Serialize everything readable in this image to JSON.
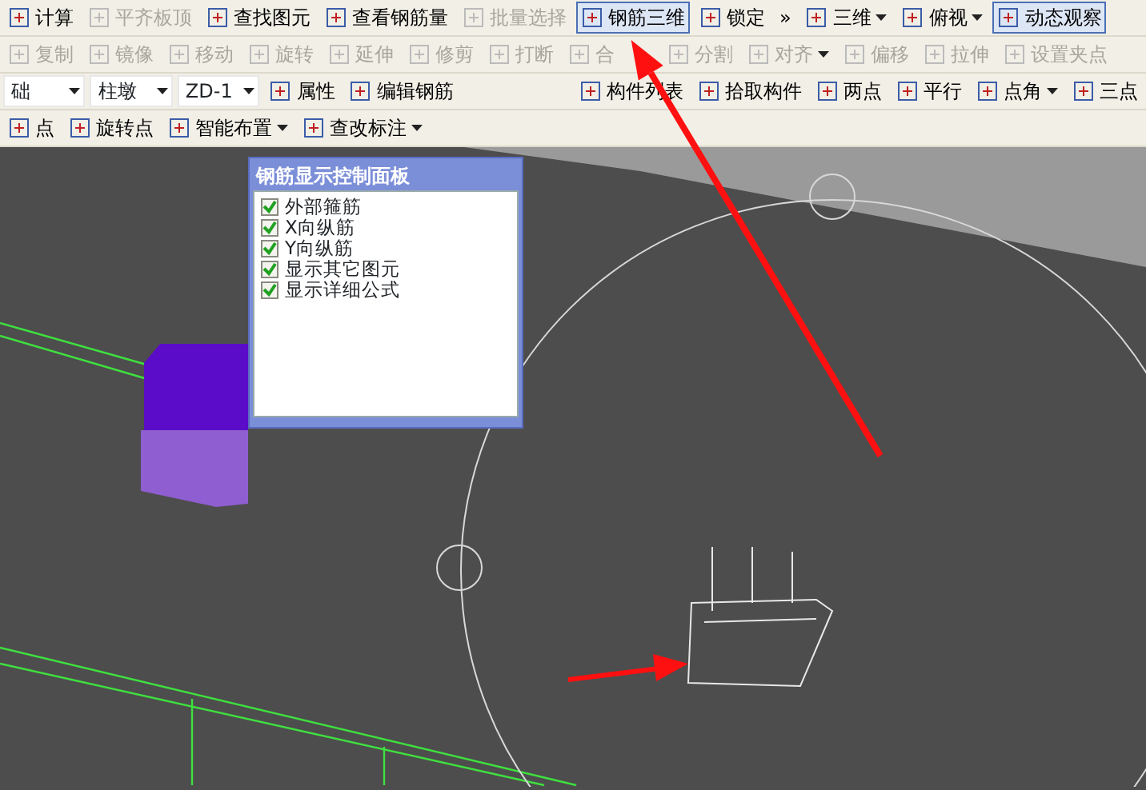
{
  "toolbars": [
    {
      "items": [
        {
          "kind": "button",
          "label": "计算",
          "disabled": false,
          "pressed": false
        },
        {
          "kind": "button",
          "label": "平齐板顶",
          "disabled": true,
          "pressed": false
        },
        {
          "kind": "button",
          "label": "查找图元",
          "disabled": false,
          "pressed": false
        },
        {
          "kind": "button",
          "label": "查看钢筋量",
          "disabled": false,
          "pressed": false
        },
        {
          "kind": "button",
          "label": "批量选择",
          "disabled": true,
          "pressed": false
        },
        {
          "kind": "button",
          "label": "钢筋三维",
          "disabled": false,
          "pressed": true
        },
        {
          "kind": "button",
          "label": "锁定",
          "disabled": false,
          "pressed": false
        },
        {
          "kind": "more",
          "label": "»",
          "disabled": false,
          "pressed": false
        },
        {
          "kind": "dropdown",
          "label": "三维",
          "disabled": false,
          "pressed": false
        },
        {
          "kind": "dropdown",
          "label": "俯视",
          "disabled": false,
          "pressed": false
        },
        {
          "kind": "button",
          "label": "动态观察",
          "disabled": false,
          "pressed": true
        }
      ]
    },
    {
      "items": [
        {
          "kind": "button",
          "label": "复制",
          "disabled": true,
          "pressed": false
        },
        {
          "kind": "button",
          "label": "镜像",
          "disabled": true,
          "pressed": false
        },
        {
          "kind": "button",
          "label": "移动",
          "disabled": true,
          "pressed": false
        },
        {
          "kind": "button",
          "label": "旋转",
          "disabled": true,
          "pressed": false
        },
        {
          "kind": "button",
          "label": "延伸",
          "disabled": true,
          "pressed": false
        },
        {
          "kind": "button",
          "label": "修剪",
          "disabled": true,
          "pressed": false
        },
        {
          "kind": "button",
          "label": "打断",
          "disabled": true,
          "pressed": false
        },
        {
          "kind": "button",
          "label": "合",
          "disabled": true,
          "pressed": false
        },
        {
          "kind": "button",
          "label": "分割",
          "disabled": true,
          "pressed": false
        },
        {
          "kind": "dropdown",
          "label": "对齐",
          "disabled": true,
          "pressed": false
        },
        {
          "kind": "button",
          "label": "偏移",
          "disabled": true,
          "pressed": false
        },
        {
          "kind": "button",
          "label": "拉伸",
          "disabled": true,
          "pressed": false
        },
        {
          "kind": "button",
          "label": "设置夹点",
          "disabled": true,
          "pressed": false
        }
      ]
    },
    {
      "items": [
        {
          "kind": "select",
          "label": "础"
        },
        {
          "kind": "select",
          "label": "柱墩"
        },
        {
          "kind": "select",
          "label": "ZD-1"
        },
        {
          "kind": "button",
          "label": "属性",
          "disabled": false,
          "pressed": false
        },
        {
          "kind": "button",
          "label": "编辑钢筋",
          "disabled": false,
          "pressed": false
        },
        {
          "kind": "button",
          "label": "构件列表",
          "disabled": false,
          "pressed": false
        },
        {
          "kind": "button",
          "label": "拾取构件",
          "disabled": false,
          "pressed": false
        },
        {
          "kind": "button",
          "label": "两点",
          "disabled": false,
          "pressed": false
        },
        {
          "kind": "button",
          "label": "平行",
          "disabled": false,
          "pressed": false
        },
        {
          "kind": "dropdown",
          "label": "点角",
          "disabled": false,
          "pressed": false
        },
        {
          "kind": "button",
          "label": "三点",
          "disabled": false,
          "pressed": false
        }
      ]
    },
    {
      "items": [
        {
          "kind": "button",
          "label": "点",
          "disabled": false,
          "pressed": false
        },
        {
          "kind": "button",
          "label": "旋转点",
          "disabled": false,
          "pressed": false
        },
        {
          "kind": "dropdown",
          "label": "智能布置",
          "disabled": false,
          "pressed": false
        },
        {
          "kind": "dropdown",
          "label": "查改标注",
          "disabled": false,
          "pressed": false
        }
      ]
    }
  ],
  "rebar_panel": {
    "title": "钢筋显示控制面板",
    "options": [
      {
        "label": "外部箍筋",
        "checked": true
      },
      {
        "label": "X向纵筋",
        "checked": true
      },
      {
        "label": "Y向纵筋",
        "checked": true
      },
      {
        "label": "显示其它图元",
        "checked": true
      },
      {
        "label": "显示详细公式",
        "checked": true
      }
    ]
  }
}
